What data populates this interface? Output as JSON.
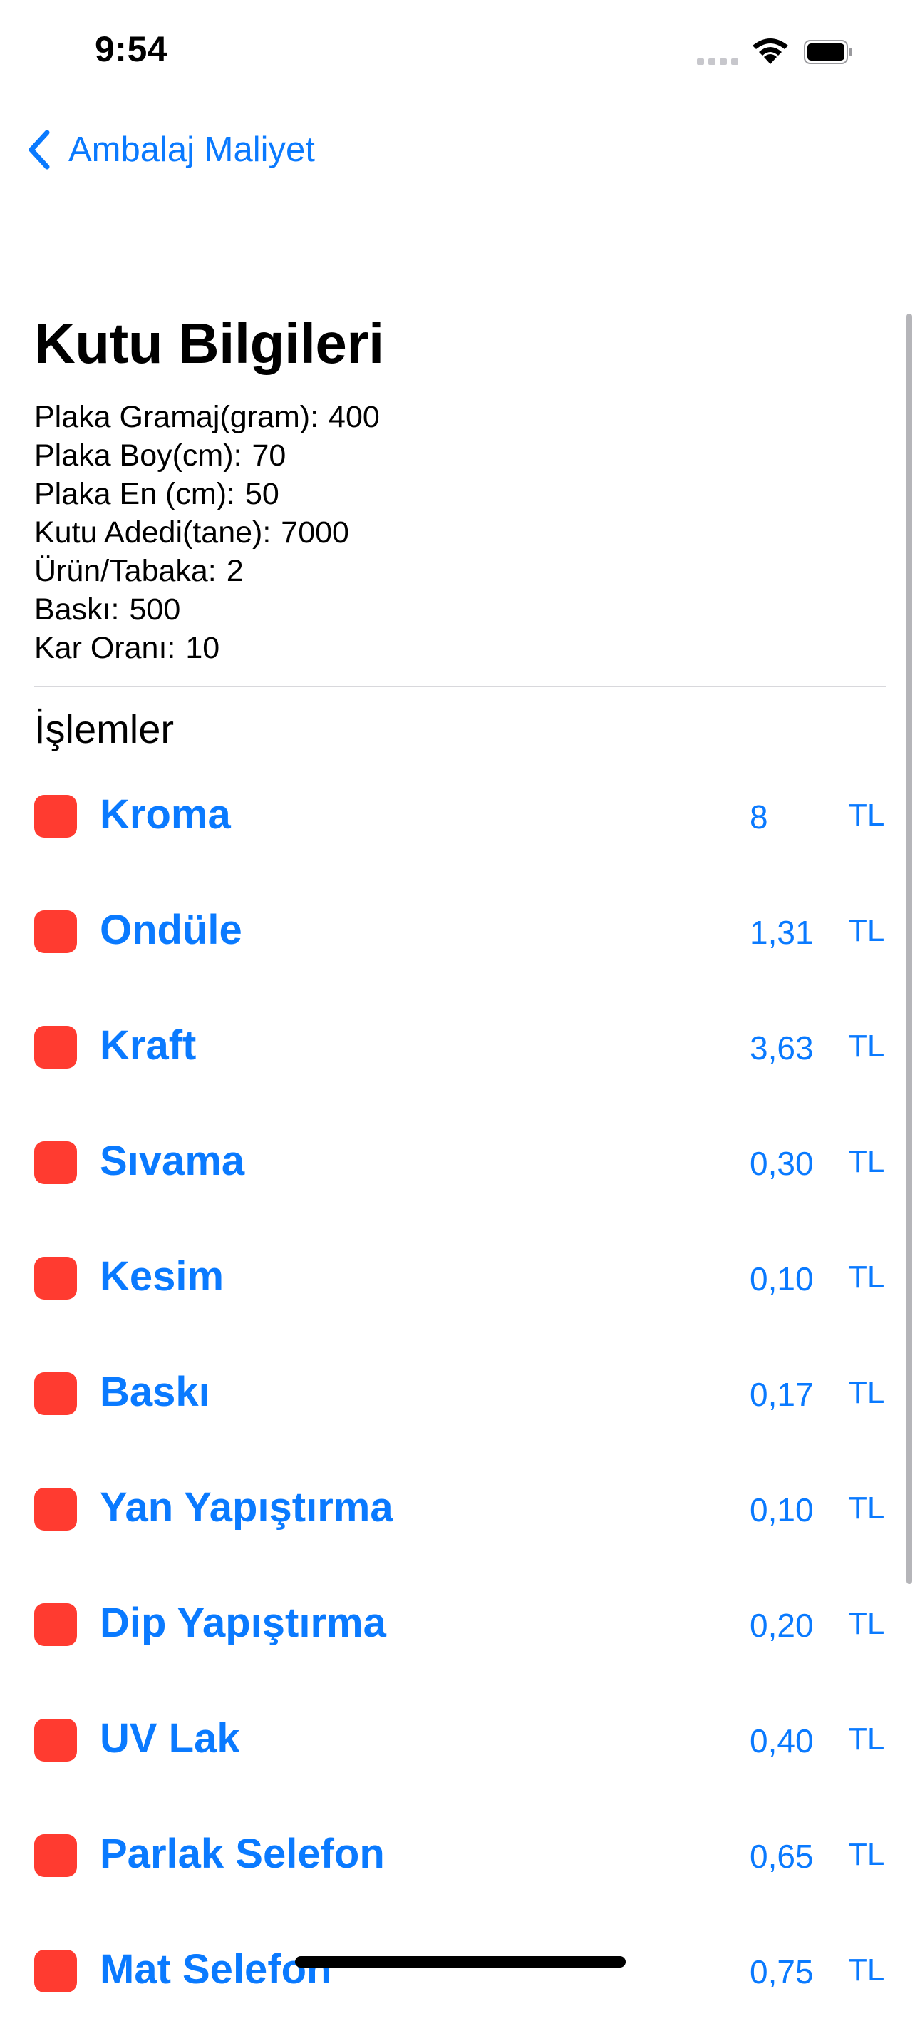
{
  "status_bar": {
    "time": "9:54"
  },
  "nav": {
    "back_label": "Ambalaj Maliyet",
    "back_icon": "chevron-left-icon"
  },
  "title": "Kutu Bilgileri",
  "info": [
    {
      "label": "Plaka Gramaj(gram):",
      "value": "400"
    },
    {
      "label": "Plaka Boy(cm):",
      "value": "70"
    },
    {
      "label": "Plaka En (cm):",
      "value": "50"
    },
    {
      "label": "Kutu Adedi(tane):",
      "value": "7000"
    },
    {
      "label": "Ürün/Tabaka:",
      "value": "2"
    },
    {
      "label": "Baskı:",
      "value": "500"
    },
    {
      "label": "Kar Oranı:",
      "value": "10"
    }
  ],
  "section_title": "İşlemler",
  "operations": [
    {
      "name": "Kroma",
      "price": "8",
      "unit": "TL",
      "checked": true
    },
    {
      "name": "Ondüle",
      "price": "1,31",
      "unit": "TL",
      "checked": true
    },
    {
      "name": "Kraft",
      "price": "3,63",
      "unit": "TL",
      "checked": true
    },
    {
      "name": "Sıvama",
      "price": "0,30",
      "unit": "TL",
      "checked": true
    },
    {
      "name": "Kesim",
      "price": "0,10",
      "unit": "TL",
      "checked": true
    },
    {
      "name": "Baskı",
      "price": "0,17",
      "unit": "TL",
      "checked": true
    },
    {
      "name": "Yan Yapıştırma",
      "price": "0,10",
      "unit": "TL",
      "checked": true
    },
    {
      "name": "Dip Yapıştırma",
      "price": "0,20",
      "unit": "TL",
      "checked": true
    },
    {
      "name": "UV Lak",
      "price": "0,40",
      "unit": "TL",
      "checked": true
    },
    {
      "name": "Parlak Selefon",
      "price": "0,65",
      "unit": "TL",
      "checked": true
    },
    {
      "name": "Mat Selefon",
      "price": "0,75",
      "unit": "TL",
      "checked": true
    }
  ],
  "colors": {
    "accent": "#0a7aff",
    "checkbox": "#ff3b30",
    "divider": "#d8d8dc"
  }
}
